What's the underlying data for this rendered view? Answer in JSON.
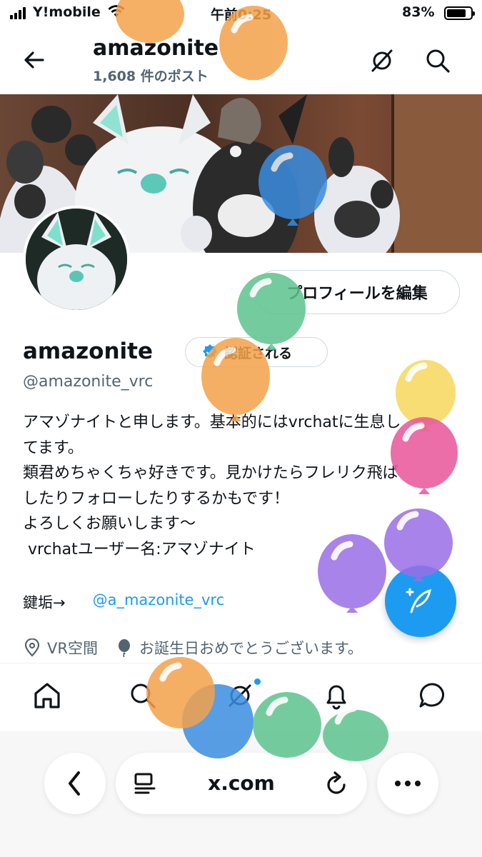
{
  "status_bar": {
    "carrier": "Y!mobile",
    "time": "午前0:25",
    "battery": "83%",
    "battery_level": 0.83
  },
  "header": {
    "name": "amazonite",
    "post_count": "1,608 件のポスト"
  },
  "profile": {
    "edit_button": "プロフィールを編集",
    "display_name": "amazonite",
    "verify_button": "認証される",
    "handle": "@amazonite_vrc",
    "bio_lines": [
      "アマゾナイトと申します。基本的にはvrchatに生息し",
      "てます。",
      "類君めちゃくちゃ好きです。見かけたらフレリク飛ば",
      "したりフォローしたりするかもです！",
      "よろしくお願いします～",
      " vrchatユーザー名:アマゾナイト"
    ],
    "lock_label": "鍵垢→",
    "lock_link": "@a_mazonite_vrc",
    "location": "VR空間",
    "birthday": "お誕生日おめでとうございます。"
  },
  "browser": {
    "url": "x.com"
  },
  "icons": {
    "back": "back-arrow-icon",
    "grok": "grok-icon",
    "search": "search-icon",
    "home": "home-icon",
    "explore": "explore-icon",
    "notifications": "bell-icon",
    "messages": "messages-icon",
    "compose": "compose-icon",
    "location": "location-icon",
    "birthday": "balloon-icon"
  },
  "colors": {
    "accent": "#1d9bf0",
    "muted": "#536471",
    "balloon_orange": "#f4a24a",
    "balloon_blue": "#3a8de0",
    "balloon_green": "#5cc48e",
    "balloon_yellow": "#f6d85c",
    "balloon_pink": "#e8559a",
    "balloon_purple": "#9a6ee6"
  }
}
